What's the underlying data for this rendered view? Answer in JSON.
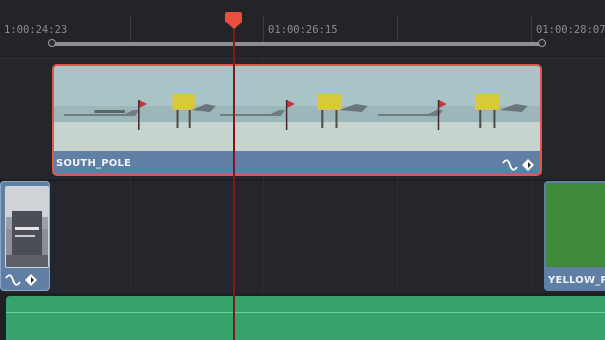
{
  "ruler": {
    "timecodes": [
      "1:00:24:23",
      "01:00:26:15",
      "01:00:28:07"
    ]
  },
  "tracks": {
    "video_upper": {
      "clip": {
        "name": "SOUTH_POLE",
        "selected": true,
        "icons": [
          "curve-icon",
          "keyframe-diamond-icon"
        ]
      }
    },
    "video_lower": {
      "left_clip": {
        "icons": [
          "curve-icon",
          "keyframe-diamond-icon"
        ]
      },
      "right_clip": {
        "name": "YELLOW_P"
      }
    },
    "audio": {
      "clip": {
        "color": "#36a36b"
      }
    }
  },
  "colors": {
    "playhead": "#ea4e3d",
    "selection_border": "#e0564a",
    "video_clip": "#5f7fa5",
    "audio_clip": "#36a36b"
  }
}
